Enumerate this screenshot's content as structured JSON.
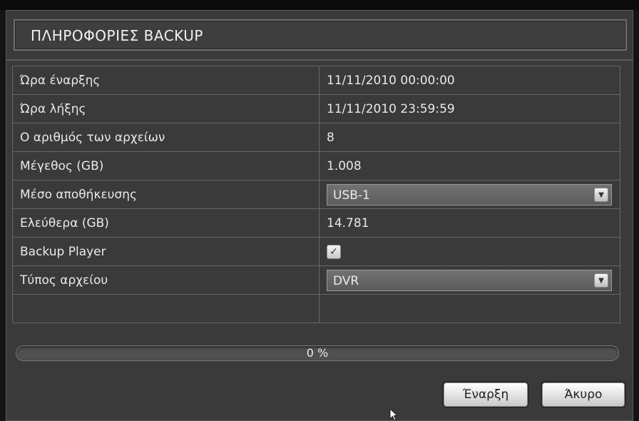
{
  "dialog": {
    "title": "ΠΛΗΡΟΦΟΡΙΕΣ BACKUP"
  },
  "rows": {
    "start_time": {
      "label": "Ώρα έναρξης",
      "value": "11/11/2010 00:00:00"
    },
    "end_time": {
      "label": "Ώρα λήξης",
      "value": "11/11/2010 23:59:59"
    },
    "file_count": {
      "label": "Ο αριθμός των αρχείων",
      "value": "8"
    },
    "size": {
      "label": "Μέγεθος (GB)",
      "value": "1.008"
    },
    "storage": {
      "label": "Μέσο αποθήκευσης",
      "value": "USB-1"
    },
    "free": {
      "label": "Ελεύθερα (GB)",
      "value": "14.781"
    },
    "player": {
      "label": "Backup Player",
      "checked": true,
      "mark": "✓"
    },
    "file_type": {
      "label": "Τύπος αρχείου",
      "value": "DVR"
    }
  },
  "progress": {
    "value": 0,
    "label": "0 %"
  },
  "buttons": {
    "start": "Έναρξη",
    "cancel": "Άκυρο"
  },
  "icons": {
    "dropdown": "▼"
  }
}
